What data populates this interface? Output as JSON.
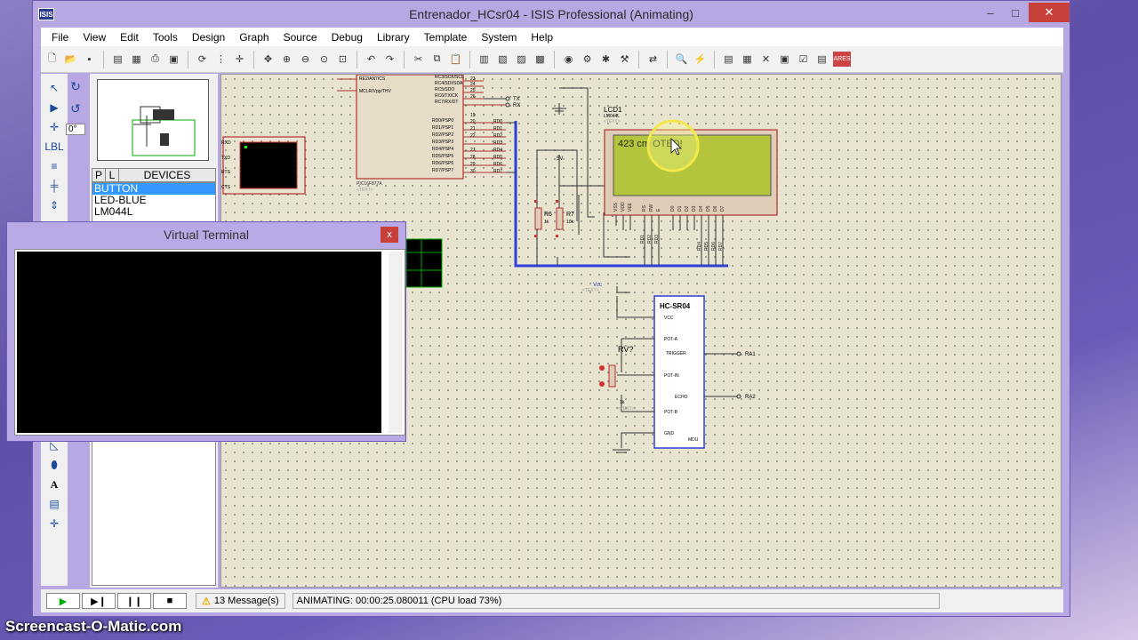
{
  "window": {
    "title": "Entrenador_HCsr04 - ISIS Professional (Animating)",
    "app_icon": "ISIS",
    "minimize": "–",
    "maximize": "□",
    "close": "✕"
  },
  "menu": [
    "File",
    "View",
    "Edit",
    "Tools",
    "Design",
    "Graph",
    "Source",
    "Debug",
    "Library",
    "Template",
    "System",
    "Help"
  ],
  "rotation": "0°",
  "devices": {
    "tab_p": "P",
    "tab_l": "L",
    "header": "DEVICES",
    "items": [
      "BUTTON",
      "LED-BLUE",
      "LM044L"
    ],
    "selected": 0
  },
  "virtual_terminal": {
    "title": "Virtual Terminal",
    "close": "x"
  },
  "schematic": {
    "mcu_label": "PIC16F877A",
    "mcu_text": "<TEXT>",
    "mcu_pins_top": [
      "RE2/AN7/CS",
      "MCLR/Vpp/THV"
    ],
    "mcu_pins_right": [
      "RC3/SCK/SCL",
      "RC4/SDI/SDA",
      "RC5/SDO",
      "RC6/TX/CK",
      "RC7/RX/DT",
      "RD0/PSP0",
      "RD1/PSP1",
      "RD2/PSP2",
      "RD3/PSP3",
      "RD4/PSP4",
      "RD5/PSP5",
      "RD6/PSP6",
      "RD7/PSP7"
    ],
    "mcu_pin_numbers": [
      "23",
      "24",
      "25",
      "26",
      "19",
      "20",
      "21",
      "22",
      "27",
      "28",
      "29",
      "30"
    ],
    "rd_nets": [
      "RD0",
      "RD1",
      "RD2",
      "RD3",
      "RD4",
      "RD5",
      "RD6",
      "RD7"
    ],
    "tx": "TX",
    "rx": "RX",
    "term_pins": [
      "RXD",
      "TXD",
      "RTS",
      "CTS"
    ],
    "lcd": {
      "name": "LCD1",
      "model": "LM044L",
      "text": "<TEXT>",
      "display": "423 cm OTED!",
      "pins": [
        "VSS",
        "VDD",
        "VEE",
        "RS",
        "RW",
        "E",
        "D0",
        "D1",
        "D2",
        "D3",
        "D4",
        "D5",
        "D6",
        "D7"
      ],
      "nets_bottom": [
        "RD1",
        "RD2",
        "RD3",
        "RD4",
        "RD5",
        "RD6",
        "RD7"
      ]
    },
    "r6": {
      "name": "R6",
      "value": "1k"
    },
    "r7": {
      "name": "R7",
      "value": "10k"
    },
    "vcc_label": "5V",
    "hcsr04": {
      "name": "HC-SR04",
      "pins_left": [
        "VCC",
        "POT-A",
        "POT-IN",
        "POT-B",
        "GND"
      ],
      "pins_right": [
        "TRIGGER",
        "ECHO"
      ],
      "footer": "MDU",
      "nets_right": [
        "RA1",
        "RA2"
      ]
    },
    "rv": {
      "name": "RV?",
      "value": "1k",
      "text": "<TEXT>"
    },
    "vcc_net": "Vcc",
    "vcc_text": "<TEXT>"
  },
  "status": {
    "play": "▶",
    "step": "▶❙",
    "pause": "❙❙",
    "stop": "■",
    "warning_icon": "⚠",
    "messages": "13 Message(s)",
    "animating": "ANIMATING: 00:00:25.080011 (CPU load 73%)"
  },
  "watermark": "Screencast-O-Matic.com",
  "colors": {
    "accent": "#3399ff",
    "lcd_bg": "#b4c43c",
    "wire_blue": "#2d3fd8",
    "component_red": "#b03030"
  }
}
